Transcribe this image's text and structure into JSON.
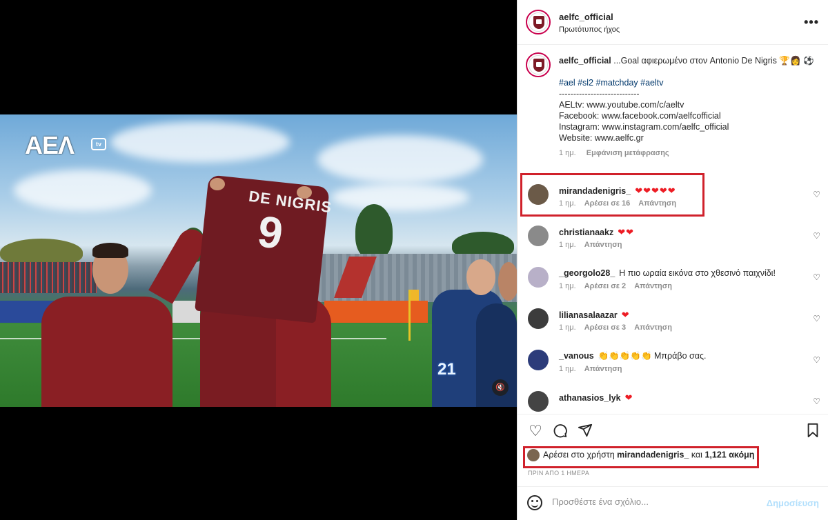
{
  "video": {
    "logo_text": "ΑΕΛ",
    "logo_tv": "tv",
    "jersey_name": "DE NIGRIS",
    "jersey_number": "9",
    "watermark": "21",
    "mute_icon": "muted-speaker-icon"
  },
  "header": {
    "username": "aelfc_official",
    "audio": "Πρωτότυπος ήχος",
    "more_icon": "more-options-icon"
  },
  "caption": {
    "username": "aelfc_official",
    "text": "...Goal αφιερωμένο στον Antonio De Nigris 🏆👩 ⚽",
    "hashtags": "#ael #sl2 #matchday #aeltv",
    "separator": "----------------------------",
    "line1": "AELtv: www.youtube.com/c/aeltv",
    "line2": "Facebook: www.facebook.com/aelfcofficial",
    "line3": "Instagram: www.instagram.com/aelfc_official",
    "line4": "Website: www.aelfc.gr",
    "time": "1 ημ.",
    "translate": "Εμφάνιση μετάφρασης"
  },
  "comments": [
    {
      "user": "mirandadenigris_",
      "text": "❤❤❤❤❤",
      "time": "1 ημ.",
      "likes": "Αρέσει σε 16",
      "reply": "Απάντηση",
      "avatar_color": "#6b5a48"
    },
    {
      "user": "christianaakz",
      "text": "❤❤",
      "time": "1 ημ.",
      "likes": "",
      "reply": "Απάντηση",
      "avatar_color": "#8a8a8a"
    },
    {
      "user": "_georgolo28_",
      "text": "Η πιο ωραία εικόνα στο χθεσινό παιχνίδι!",
      "time": "1 ημ.",
      "likes": "Αρέσει σε 2",
      "reply": "Απάντηση",
      "avatar_color": "#b8b0c8"
    },
    {
      "user": "lilianasalaazar",
      "text": "❤",
      "time": "1 ημ.",
      "likes": "Αρέσει σε 3",
      "reply": "Απάντηση",
      "avatar_color": "#3c3c3c"
    },
    {
      "user": "_vanous",
      "text": "👏👏👏👏👏 Μπράβο σας.",
      "time": "1 ημ.",
      "likes": "",
      "reply": "Απάντηση",
      "avatar_color": "#2c3c7a"
    },
    {
      "user": "athanasios_lyk",
      "text": "❤",
      "time": "",
      "likes": "",
      "reply": "",
      "avatar_color": "#444444"
    }
  ],
  "actions": {
    "like_icon": "heart-icon",
    "comment_icon": "comment-icon",
    "share_icon": "send-icon",
    "save_icon": "bookmark-icon"
  },
  "likes": {
    "prefix": "Αρέσει στο χρήστη",
    "user": "mirandadenigris_",
    "middle": "και",
    "count": "1,121 ακόμη"
  },
  "timestamp": "ΠΡΙΝ ΑΠΟ 1 ΗΜΕΡΑ",
  "comment_box": {
    "placeholder": "Προσθέστε ένα σχόλιο...",
    "post_label": "Δημοσίευση",
    "emoji_icon": "emoji-icon"
  },
  "colors": {
    "highlight_box": "#d0212b",
    "hashtag": "#00376b",
    "post_disabled": "#b2dffc",
    "heart_red": "#ed1c24"
  }
}
